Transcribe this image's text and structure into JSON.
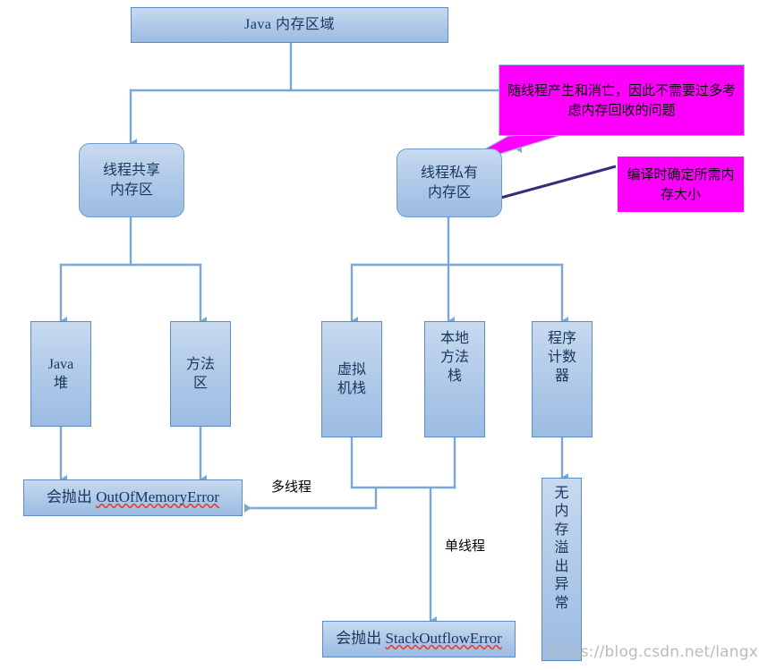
{
  "diagram": {
    "title": "Java 内存区域",
    "background_color": "#ffffff",
    "node_fill": "#b2cbe8",
    "node_border": "#5b8dc0",
    "connector_color": "#7ba7d4",
    "callout_color": "#ff00ff",
    "pointer_line_color": "#3b2a7a",
    "nodes": {
      "root": "Java 内存区域",
      "shared": "线程共享\n内存区",
      "private": "线程私有\n内存区",
      "heap_line1": "Java",
      "heap_line2": "堆",
      "method_area_line1": "方法",
      "method_area_line2": "区",
      "vm_stack_line1": "虚拟",
      "vm_stack_line2": "机栈",
      "native_stack_line1": "本地",
      "native_stack_line2": "方法",
      "native_stack_line3": "栈",
      "pc_line1": "程序",
      "pc_line2": "计数",
      "pc_line3": "器",
      "oom_prefix": "会抛出 ",
      "oom_error": "OutOfMemoryError",
      "sof_prefix": "会抛出 ",
      "sof_error": "StackOutflowError",
      "no_oom_chars": "无\n内\n存\n溢\n出\n异\n常"
    },
    "callouts": {
      "thread_lifecycle": "随线程产生和消亡，因此不需要过多考虑内存回收的问题",
      "compile_time_size": "编译时确定所需内存大小"
    },
    "edge_labels": {
      "multi_thread": "多线程",
      "single_thread": "单线程"
    },
    "watermark": "https://blog.csdn.net/langxiaolin"
  }
}
